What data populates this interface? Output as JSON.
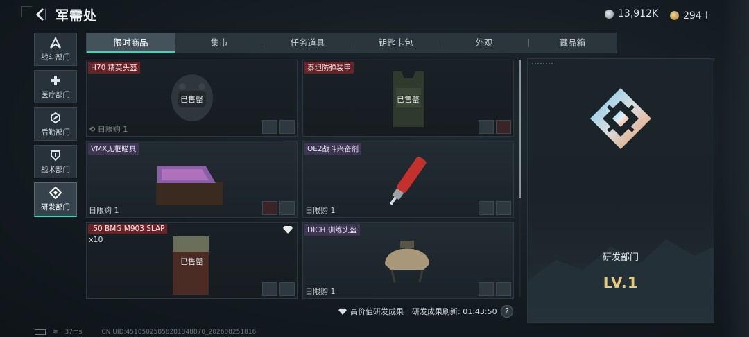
{
  "header": {
    "title": "军需处",
    "back_icon": "back-arrow-icon"
  },
  "currencies": [
    {
      "icon": "silver-coin-icon",
      "value": "13,912K"
    },
    {
      "icon": "gold-coin-icon",
      "value": "294＋"
    }
  ],
  "sidebar": [
    {
      "label": "战斗部门",
      "icon": "combat-icon"
    },
    {
      "label": "医疗部门",
      "icon": "medical-cross-icon"
    },
    {
      "label": "后勤部门",
      "icon": "logistics-icon"
    },
    {
      "label": "战术部门",
      "icon": "tactics-shield-icon"
    },
    {
      "label": "研发部门",
      "icon": "research-icon",
      "active": true
    }
  ],
  "tabs": [
    "限时商品",
    "集市",
    "任务道具",
    "钥匙卡包",
    "外观",
    "藏品箱"
  ],
  "active_tab": "限时商品",
  "items": [
    {
      "name": "H70 精英头盔",
      "tag_color": "red",
      "status": "已售罄",
      "limit": "日限购 1"
    },
    {
      "name": "泰坦防弹装甲",
      "tag_color": "red",
      "status": "已售罄"
    },
    {
      "name": "VMX无框瞄具",
      "tag_color": "purple",
      "limit": "日限购 1"
    },
    {
      "name": "OE2战斗兴奋剂",
      "tag_color": "purple",
      "limit": "日限购 1"
    },
    {
      "name": ".50 BMG M903 SLAP",
      "tag_color": "red",
      "status": "已售罄",
      "quantity": "x10"
    },
    {
      "name": "DICH 训练头盔",
      "tag_color": "purple",
      "limit": "日限购 1"
    }
  ],
  "footer": {
    "high_value": "高价值研发成果",
    "refresh": "研发成果刷新: 01:43:50",
    "help": "?"
  },
  "status_bar": {
    "ping": "37ms",
    "uid": "CN UID:4510502585828134887­0_202608251816"
  },
  "panel": {
    "department": "研发部门",
    "level": "LV.1"
  },
  "colors": {
    "accent": "#25e0b8",
    "level_gold": "#e8c978",
    "sold_tag": "#6a2226",
    "purple_tag": "#3d3552"
  }
}
